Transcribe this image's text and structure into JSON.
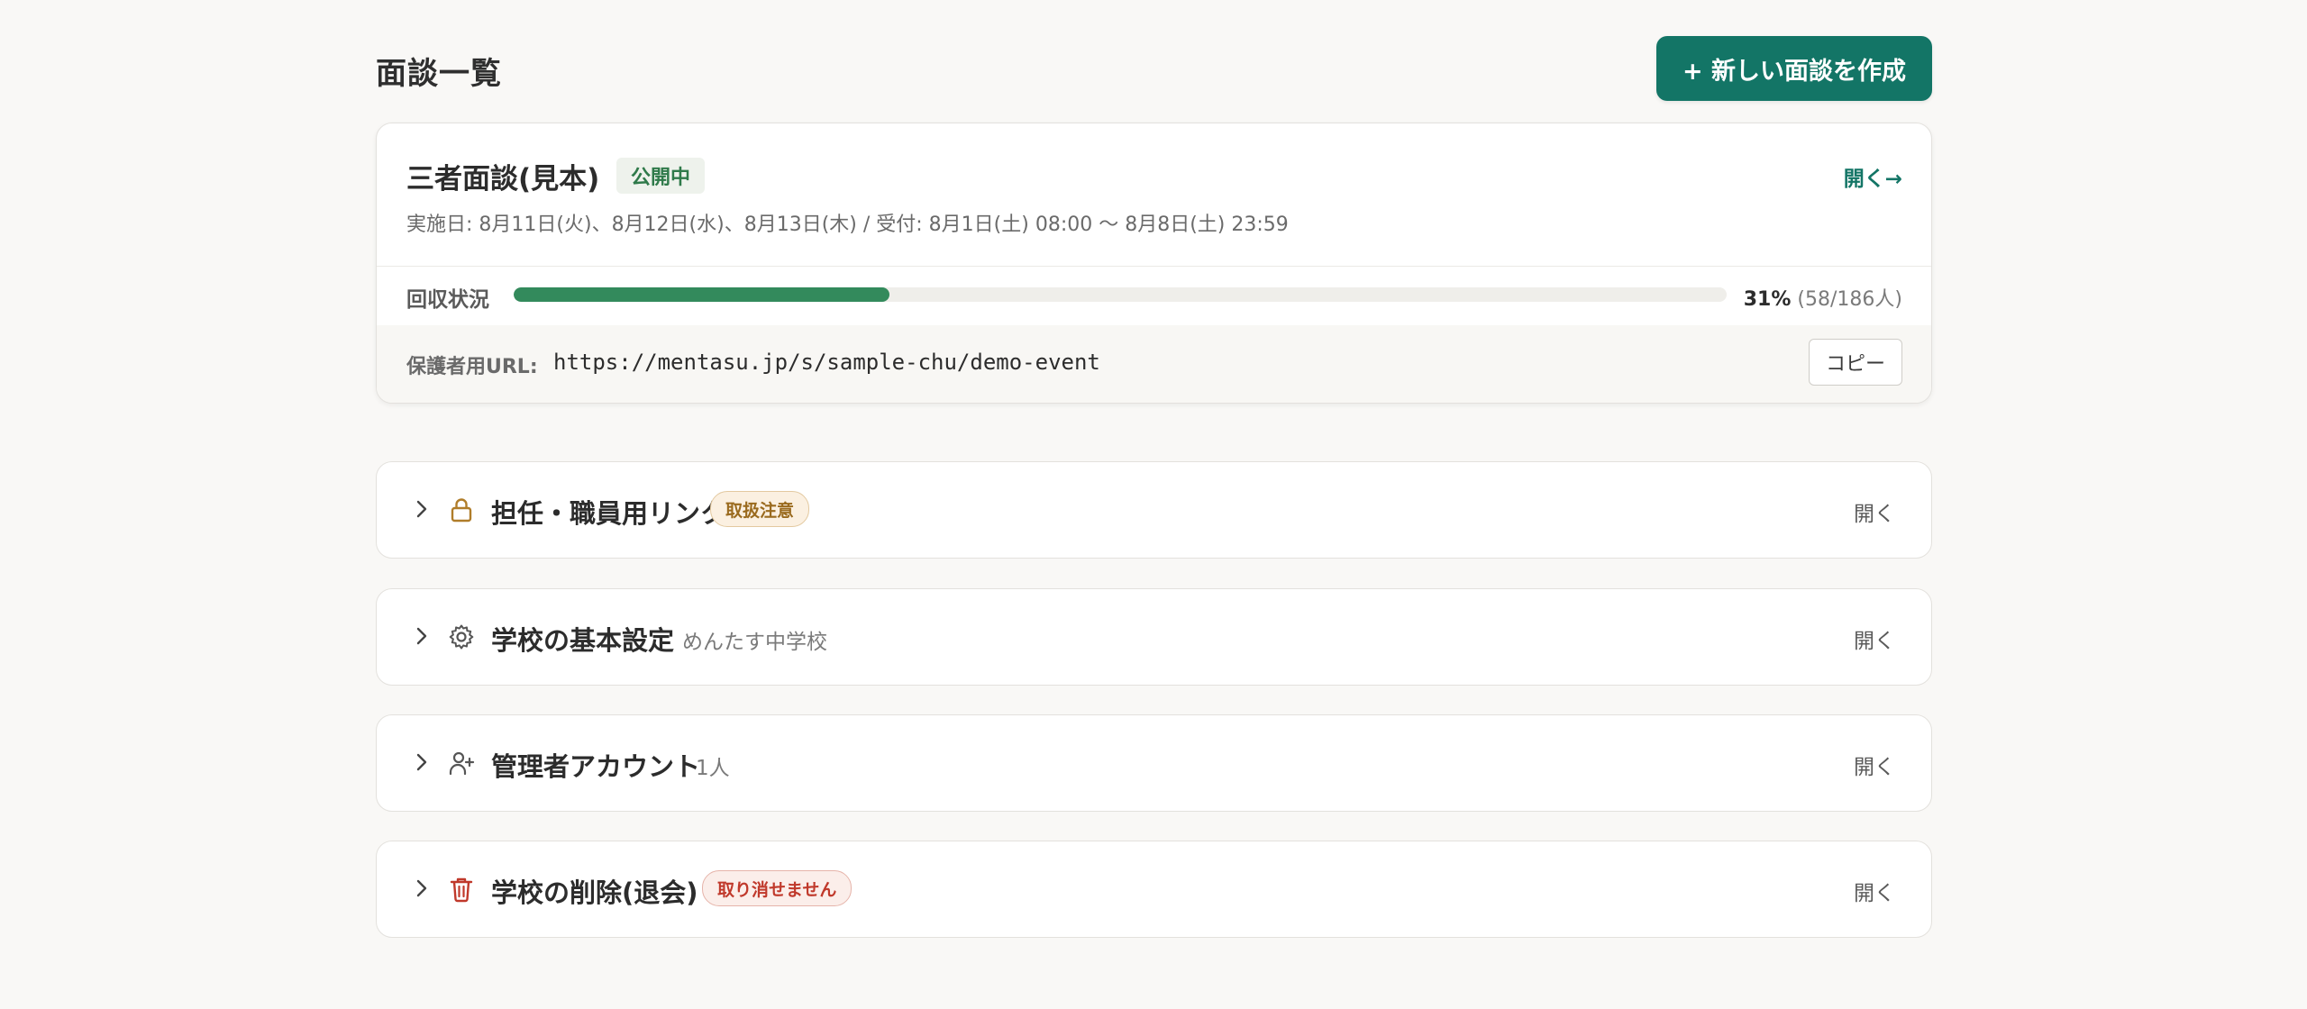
{
  "header": {
    "title": "面談一覧",
    "new_button_label": "+ 新しい面談を作成"
  },
  "event": {
    "title": "三者面談(見本)",
    "status": "公開中",
    "open_label": "開く→",
    "schedule": "実施日: 8月11日(火)、8月12日(水)、8月13日(木) / 受付: 8月1日(土) 08:00 〜 8月8日(土) 23:59",
    "progress": {
      "label": "回収状況",
      "percent": 31,
      "percent_text": "31%",
      "count_text": "(58/186人)"
    },
    "url": {
      "label": "保護者用URL:",
      "value": "https://mentasu.jp/s/sample-chu/demo-event",
      "copy_label": "コピー"
    }
  },
  "sections": [
    {
      "title": "担任・職員用リンク",
      "badge": "取扱注意",
      "icon": "lock-icon",
      "open_label": "開く"
    },
    {
      "title": "学校の基本設定",
      "subtitle": "めんたす中学校",
      "icon": "gear-icon",
      "open_label": "開く"
    },
    {
      "title": "管理者アカウント",
      "subtitle": "1人",
      "icon": "user-plus-icon",
      "open_label": "開く"
    },
    {
      "title": "学校の削除(退会)",
      "badge": "取り消せません",
      "icon": "trash-icon",
      "open_label": "開く"
    }
  ],
  "colors": {
    "brand": "#137566",
    "progress": "#338a5c",
    "caution": "#9a6a1e",
    "danger": "#c0392b"
  }
}
